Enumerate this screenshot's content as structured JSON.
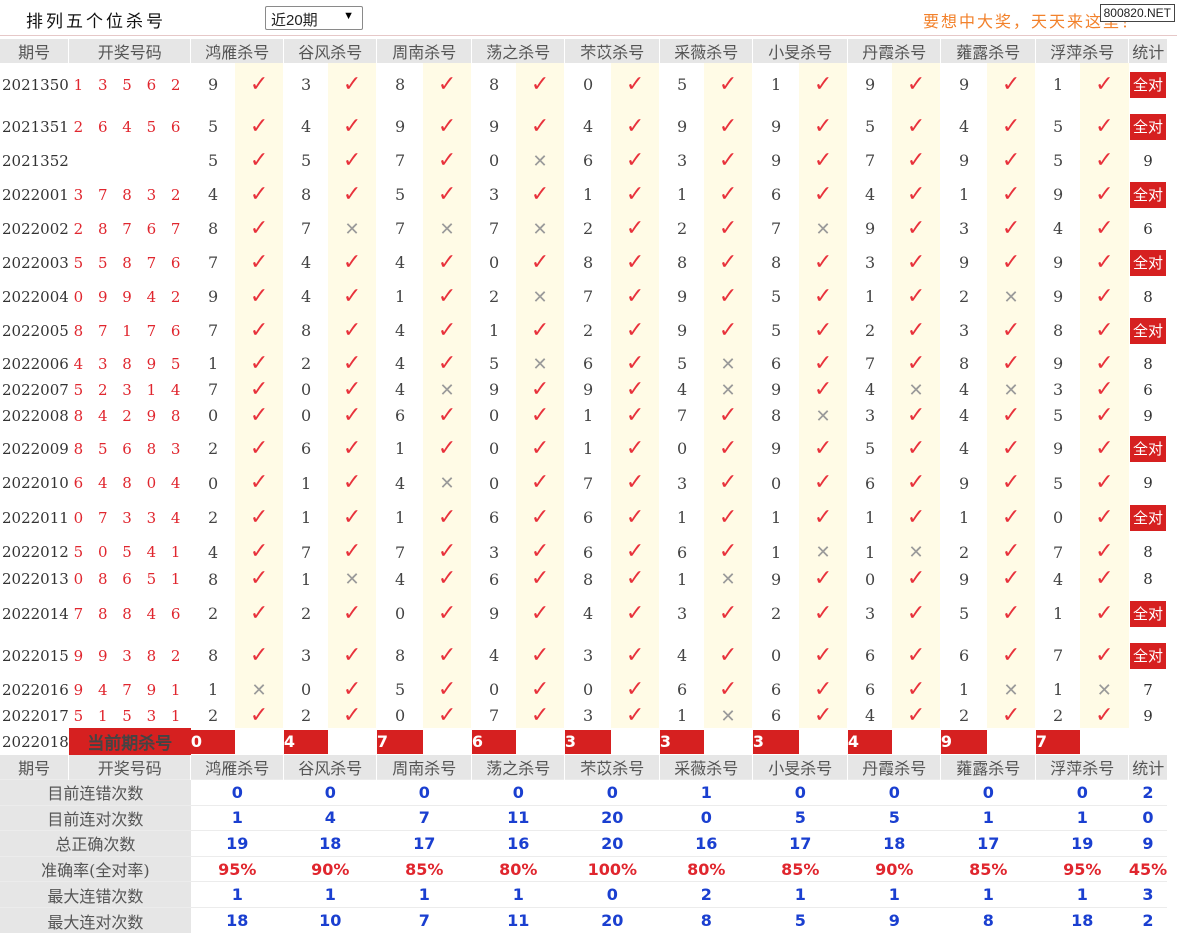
{
  "header": {
    "title": "排列五个位杀号",
    "period_select": "近20期",
    "slogan": "要想中大奖，天天来这里！",
    "watermark": "800820.NET"
  },
  "columns": {
    "period": "期号",
    "number": "开奖号码",
    "experts": [
      "鸿雁杀号",
      "谷风杀号",
      "周南杀号",
      "荡之杀号",
      "芣苡杀号",
      "采薇杀号",
      "小旻杀号",
      "丹霞杀号",
      "蕹露杀号",
      "浮萍杀号"
    ],
    "stat": "统计"
  },
  "rows": [
    {
      "period": "2021350",
      "number": "1 3 5 6 2",
      "cells": [
        {
          "v": "9",
          "ok": true
        },
        {
          "v": "3",
          "ok": true
        },
        {
          "v": "8",
          "ok": true
        },
        {
          "v": "8",
          "ok": true
        },
        {
          "v": "0",
          "ok": true
        },
        {
          "v": "5",
          "ok": true
        },
        {
          "v": "1",
          "ok": true
        },
        {
          "v": "9",
          "ok": true
        },
        {
          "v": "9",
          "ok": true
        },
        {
          "v": "1",
          "ok": true
        }
      ],
      "stat": "全对"
    },
    {
      "period": "2021351",
      "number": "2 6 4 5 6",
      "cells": [
        {
          "v": "5",
          "ok": true
        },
        {
          "v": "4",
          "ok": true
        },
        {
          "v": "9",
          "ok": true
        },
        {
          "v": "9",
          "ok": true
        },
        {
          "v": "4",
          "ok": true
        },
        {
          "v": "9",
          "ok": true
        },
        {
          "v": "9",
          "ok": true
        },
        {
          "v": "5",
          "ok": true
        },
        {
          "v": "4",
          "ok": true
        },
        {
          "v": "5",
          "ok": true
        }
      ],
      "stat": "全对"
    },
    {
      "period": "2021352",
      "number": "",
      "cells": [
        {
          "v": "5",
          "ok": true
        },
        {
          "v": "5",
          "ok": true
        },
        {
          "v": "7",
          "ok": true
        },
        {
          "v": "0",
          "ok": false
        },
        {
          "v": "6",
          "ok": true
        },
        {
          "v": "3",
          "ok": true
        },
        {
          "v": "9",
          "ok": true
        },
        {
          "v": "7",
          "ok": true
        },
        {
          "v": "9",
          "ok": true
        },
        {
          "v": "5",
          "ok": true
        }
      ],
      "stat": "9"
    },
    {
      "period": "2022001",
      "number": "3 7 8 3 2",
      "cells": [
        {
          "v": "4",
          "ok": true
        },
        {
          "v": "8",
          "ok": true
        },
        {
          "v": "5",
          "ok": true
        },
        {
          "v": "3",
          "ok": true
        },
        {
          "v": "1",
          "ok": true
        },
        {
          "v": "1",
          "ok": true
        },
        {
          "v": "6",
          "ok": true
        },
        {
          "v": "4",
          "ok": true
        },
        {
          "v": "1",
          "ok": true
        },
        {
          "v": "9",
          "ok": true
        }
      ],
      "stat": "全对"
    },
    {
      "period": "2022002",
      "number": "2 8 7 6 7",
      "cells": [
        {
          "v": "8",
          "ok": true
        },
        {
          "v": "7",
          "ok": false
        },
        {
          "v": "7",
          "ok": false
        },
        {
          "v": "7",
          "ok": false
        },
        {
          "v": "2",
          "ok": true
        },
        {
          "v": "2",
          "ok": true
        },
        {
          "v": "7",
          "ok": false
        },
        {
          "v": "9",
          "ok": true
        },
        {
          "v": "3",
          "ok": true
        },
        {
          "v": "4",
          "ok": true
        }
      ],
      "stat": "6"
    },
    {
      "period": "2022003",
      "number": "5 5 8 7 6",
      "cells": [
        {
          "v": "7",
          "ok": true
        },
        {
          "v": "4",
          "ok": true
        },
        {
          "v": "4",
          "ok": true
        },
        {
          "v": "0",
          "ok": true
        },
        {
          "v": "8",
          "ok": true
        },
        {
          "v": "8",
          "ok": true
        },
        {
          "v": "8",
          "ok": true
        },
        {
          "v": "3",
          "ok": true
        },
        {
          "v": "9",
          "ok": true
        },
        {
          "v": "9",
          "ok": true
        }
      ],
      "stat": "全对"
    },
    {
      "period": "2022004",
      "number": "0 9 9 4 2",
      "cells": [
        {
          "v": "9",
          "ok": true
        },
        {
          "v": "4",
          "ok": true
        },
        {
          "v": "1",
          "ok": true
        },
        {
          "v": "2",
          "ok": false
        },
        {
          "v": "7",
          "ok": true
        },
        {
          "v": "9",
          "ok": true
        },
        {
          "v": "5",
          "ok": true
        },
        {
          "v": "1",
          "ok": true
        },
        {
          "v": "2",
          "ok": false
        },
        {
          "v": "9",
          "ok": true
        }
      ],
      "stat": "8"
    },
    {
      "period": "2022005",
      "number": "8 7 1 7 6",
      "cells": [
        {
          "v": "7",
          "ok": true
        },
        {
          "v": "8",
          "ok": true
        },
        {
          "v": "4",
          "ok": true
        },
        {
          "v": "1",
          "ok": true
        },
        {
          "v": "2",
          "ok": true
        },
        {
          "v": "9",
          "ok": true
        },
        {
          "v": "5",
          "ok": true
        },
        {
          "v": "2",
          "ok": true
        },
        {
          "v": "3",
          "ok": true
        },
        {
          "v": "8",
          "ok": true
        }
      ],
      "stat": "全对"
    },
    {
      "period": "2022006",
      "number": "4 3 8 9 5",
      "cells": [
        {
          "v": "1",
          "ok": true
        },
        {
          "v": "2",
          "ok": true
        },
        {
          "v": "4",
          "ok": true
        },
        {
          "v": "5",
          "ok": false
        },
        {
          "v": "6",
          "ok": true
        },
        {
          "v": "5",
          "ok": false
        },
        {
          "v": "6",
          "ok": true
        },
        {
          "v": "7",
          "ok": true
        },
        {
          "v": "8",
          "ok": true
        },
        {
          "v": "9",
          "ok": true
        }
      ],
      "stat": "8"
    },
    {
      "period": "2022007",
      "number": "5 2 3 1 4",
      "cells": [
        {
          "v": "7",
          "ok": true
        },
        {
          "v": "0",
          "ok": true
        },
        {
          "v": "4",
          "ok": false
        },
        {
          "v": "9",
          "ok": true
        },
        {
          "v": "9",
          "ok": true
        },
        {
          "v": "4",
          "ok": false
        },
        {
          "v": "9",
          "ok": true
        },
        {
          "v": "4",
          "ok": false
        },
        {
          "v": "4",
          "ok": false
        },
        {
          "v": "3",
          "ok": true
        }
      ],
      "stat": "6"
    },
    {
      "period": "2022008",
      "number": "8 4 2 9 8",
      "cells": [
        {
          "v": "0",
          "ok": true
        },
        {
          "v": "0",
          "ok": true
        },
        {
          "v": "6",
          "ok": true
        },
        {
          "v": "0",
          "ok": true
        },
        {
          "v": "1",
          "ok": true
        },
        {
          "v": "7",
          "ok": true
        },
        {
          "v": "8",
          "ok": false
        },
        {
          "v": "3",
          "ok": true
        },
        {
          "v": "4",
          "ok": true
        },
        {
          "v": "5",
          "ok": true
        }
      ],
      "stat": "9"
    },
    {
      "period": "2022009",
      "number": "8 5 6 8 3",
      "cells": [
        {
          "v": "2",
          "ok": true
        },
        {
          "v": "6",
          "ok": true
        },
        {
          "v": "1",
          "ok": true
        },
        {
          "v": "0",
          "ok": true
        },
        {
          "v": "1",
          "ok": true
        },
        {
          "v": "0",
          "ok": true
        },
        {
          "v": "9",
          "ok": true
        },
        {
          "v": "5",
          "ok": true
        },
        {
          "v": "4",
          "ok": true
        },
        {
          "v": "9",
          "ok": true
        }
      ],
      "stat": "全对"
    },
    {
      "period": "2022010",
      "number": "6 4 8 0 4",
      "cells": [
        {
          "v": "0",
          "ok": true
        },
        {
          "v": "1",
          "ok": true
        },
        {
          "v": "4",
          "ok": false
        },
        {
          "v": "0",
          "ok": true
        },
        {
          "v": "7",
          "ok": true
        },
        {
          "v": "3",
          "ok": true
        },
        {
          "v": "0",
          "ok": true
        },
        {
          "v": "6",
          "ok": true
        },
        {
          "v": "9",
          "ok": true
        },
        {
          "v": "5",
          "ok": true
        }
      ],
      "stat": "9"
    },
    {
      "period": "2022011",
      "number": "0 7 3 3 4",
      "cells": [
        {
          "v": "2",
          "ok": true
        },
        {
          "v": "1",
          "ok": true
        },
        {
          "v": "1",
          "ok": true
        },
        {
          "v": "6",
          "ok": true
        },
        {
          "v": "6",
          "ok": true
        },
        {
          "v": "1",
          "ok": true
        },
        {
          "v": "1",
          "ok": true
        },
        {
          "v": "1",
          "ok": true
        },
        {
          "v": "1",
          "ok": true
        },
        {
          "v": "0",
          "ok": true
        }
      ],
      "stat": "全对"
    },
    {
      "period": "2022012",
      "number": "5 0 5 4 1",
      "cells": [
        {
          "v": "4",
          "ok": true
        },
        {
          "v": "7",
          "ok": true
        },
        {
          "v": "7",
          "ok": true
        },
        {
          "v": "3",
          "ok": true
        },
        {
          "v": "6",
          "ok": true
        },
        {
          "v": "6",
          "ok": true
        },
        {
          "v": "1",
          "ok": false
        },
        {
          "v": "1",
          "ok": false
        },
        {
          "v": "2",
          "ok": true
        },
        {
          "v": "7",
          "ok": true
        }
      ],
      "stat": "8"
    },
    {
      "period": "2022013",
      "number": "0 8 6 5 1",
      "cells": [
        {
          "v": "8",
          "ok": true
        },
        {
          "v": "1",
          "ok": false
        },
        {
          "v": "4",
          "ok": true
        },
        {
          "v": "6",
          "ok": true
        },
        {
          "v": "8",
          "ok": true
        },
        {
          "v": "1",
          "ok": false
        },
        {
          "v": "9",
          "ok": true
        },
        {
          "v": "0",
          "ok": true
        },
        {
          "v": "9",
          "ok": true
        },
        {
          "v": "4",
          "ok": true
        }
      ],
      "stat": "8"
    },
    {
      "period": "2022014",
      "number": "7 8 8 4 6",
      "cells": [
        {
          "v": "2",
          "ok": true
        },
        {
          "v": "2",
          "ok": true
        },
        {
          "v": "0",
          "ok": true
        },
        {
          "v": "9",
          "ok": true
        },
        {
          "v": "4",
          "ok": true
        },
        {
          "v": "3",
          "ok": true
        },
        {
          "v": "2",
          "ok": true
        },
        {
          "v": "3",
          "ok": true
        },
        {
          "v": "5",
          "ok": true
        },
        {
          "v": "1",
          "ok": true
        }
      ],
      "stat": "全对"
    },
    {
      "period": "2022015",
      "number": "9 9 3 8 2",
      "cells": [
        {
          "v": "8",
          "ok": true
        },
        {
          "v": "3",
          "ok": true
        },
        {
          "v": "8",
          "ok": true
        },
        {
          "v": "4",
          "ok": true
        },
        {
          "v": "3",
          "ok": true
        },
        {
          "v": "4",
          "ok": true
        },
        {
          "v": "0",
          "ok": true
        },
        {
          "v": "6",
          "ok": true
        },
        {
          "v": "6",
          "ok": true
        },
        {
          "v": "7",
          "ok": true
        }
      ],
      "stat": "全对"
    },
    {
      "period": "2022016",
      "number": "9 4 7 9 1",
      "cells": [
        {
          "v": "1",
          "ok": false
        },
        {
          "v": "0",
          "ok": true
        },
        {
          "v": "5",
          "ok": true
        },
        {
          "v": "0",
          "ok": true
        },
        {
          "v": "0",
          "ok": true
        },
        {
          "v": "6",
          "ok": true
        },
        {
          "v": "6",
          "ok": true
        },
        {
          "v": "6",
          "ok": true
        },
        {
          "v": "1",
          "ok": false
        },
        {
          "v": "1",
          "ok": false
        }
      ],
      "stat": "7"
    },
    {
      "period": "2022017",
      "number": "5 1 5 3 1",
      "cells": [
        {
          "v": "2",
          "ok": true
        },
        {
          "v": "2",
          "ok": true
        },
        {
          "v": "0",
          "ok": true
        },
        {
          "v": "7",
          "ok": true
        },
        {
          "v": "3",
          "ok": true
        },
        {
          "v": "1",
          "ok": false
        },
        {
          "v": "6",
          "ok": true
        },
        {
          "v": "4",
          "ok": true
        },
        {
          "v": "2",
          "ok": true
        },
        {
          "v": "2",
          "ok": true
        }
      ],
      "stat": "9"
    }
  ],
  "current": {
    "period": "2022018",
    "label": "当前期杀号",
    "values": [
      "0",
      "4",
      "7",
      "6",
      "3",
      "3",
      "3",
      "4",
      "9",
      "7"
    ]
  },
  "summary": [
    {
      "label": "目前连错次数",
      "values": [
        "0",
        "0",
        "0",
        "0",
        "0",
        "1",
        "0",
        "0",
        "0",
        "0"
      ],
      "stat": "2"
    },
    {
      "label": "目前连对次数",
      "values": [
        "1",
        "4",
        "7",
        "11",
        "20",
        "0",
        "5",
        "5",
        "1",
        "1"
      ],
      "stat": "0"
    },
    {
      "label": "总正确次数",
      "values": [
        "19",
        "18",
        "17",
        "16",
        "20",
        "16",
        "17",
        "18",
        "17",
        "19"
      ],
      "stat": "9"
    },
    {
      "label": "准确率(全对率)",
      "values": [
        "95%",
        "90%",
        "85%",
        "80%",
        "100%",
        "80%",
        "85%",
        "90%",
        "85%",
        "95%"
      ],
      "stat": "45%"
    },
    {
      "label": "最大连错次数",
      "values": [
        "1",
        "1",
        "1",
        "1",
        "0",
        "2",
        "1",
        "1",
        "1",
        "1"
      ],
      "stat": "3"
    },
    {
      "label": "最大连对次数",
      "values": [
        "18",
        "10",
        "7",
        "11",
        "20",
        "8",
        "5",
        "9",
        "8",
        "18"
      ],
      "stat": "2"
    }
  ],
  "colors": {
    "accent_red": "#d62020",
    "number_red": "#e0262e",
    "check_red": "#e8323c",
    "summary_blue": "#1a3fd0",
    "header_gray": "#e6e6e6",
    "mark_cream": "#fffbe6",
    "slogan_orange": "#f2812b"
  }
}
